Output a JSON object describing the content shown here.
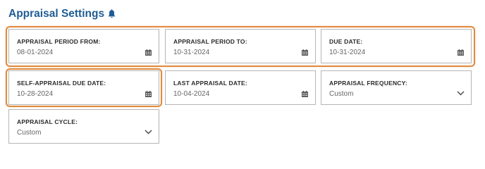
{
  "section": {
    "title": "Appraisal Settings",
    "title_icon": "bell-icon"
  },
  "fields": {
    "period_from": {
      "label": "APPRAISAL PERIOD FROM:",
      "value": "08-01-2024",
      "icon": "calendar-icon"
    },
    "period_to": {
      "label": "APPRAISAL PERIOD TO:",
      "value": "10-31-2024",
      "icon": "calendar-icon"
    },
    "due_date": {
      "label": "DUE DATE:",
      "value": "10-31-2024",
      "icon": "calendar-icon"
    },
    "self_appraisal_due": {
      "label": "SELF-APPRAISAL DUE DATE:",
      "value": "10-28-2024",
      "icon": "calendar-icon"
    },
    "last_appraisal": {
      "label": "LAST APPRAISAL DATE:",
      "value": "10-04-2024",
      "icon": "calendar-icon"
    },
    "frequency": {
      "label": "APPRAISAL FREQUENCY:",
      "value": "Custom",
      "icon": "chevron-down-icon"
    },
    "cycle": {
      "label": "APPRAISAL CYCLE:",
      "value": "Custom",
      "icon": "chevron-down-icon"
    }
  },
  "colors": {
    "title": "#1f5c94",
    "highlight": "#e08a3c",
    "field_border": "#b5b5b5",
    "label_text": "#2b2b2b",
    "value_text": "#666666"
  }
}
